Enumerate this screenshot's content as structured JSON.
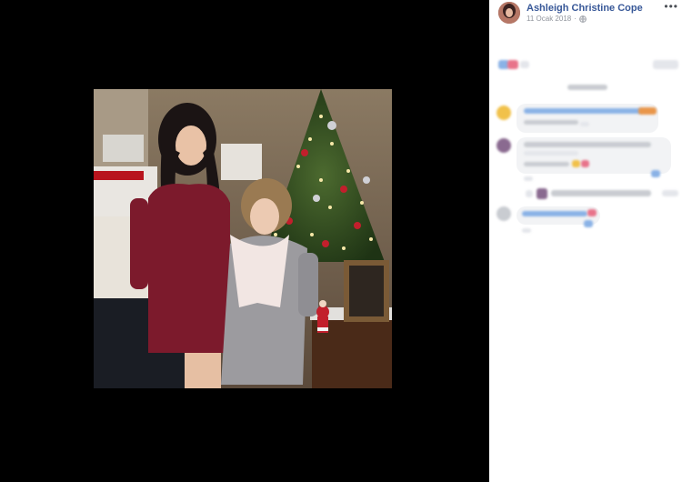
{
  "post": {
    "author": "Ashleigh Christine Cope",
    "date": "11 Ocak 2018",
    "privacy_icon": "globe-icon",
    "more_icon": "more-options-icon",
    "more_label": "•••"
  },
  "photo": {
    "description_icon": "photo"
  },
  "colors": {
    "author_link": "#385898",
    "meta_text": "#90949c",
    "sidebar_bg": "#ffffff",
    "viewer_bg": "#000000"
  }
}
